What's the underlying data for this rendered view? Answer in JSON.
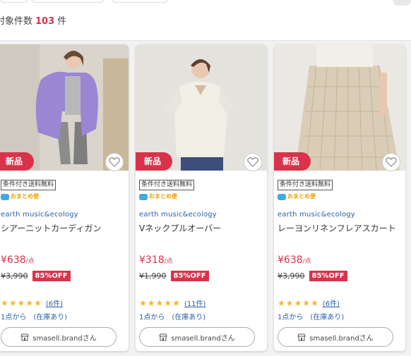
{
  "header": {
    "count_label": "対象件数",
    "count_value": "103",
    "count_unit": "件"
  },
  "products": [
    {
      "badge": "新品",
      "shipping": "条件付き送料無料",
      "bundle": "おまとめ便",
      "brand": "earth music&ecology",
      "title": "シアーニットカーディガン",
      "price": "¥638",
      "price_unit": "/点",
      "original_price": "¥3,990",
      "discount": "85%OFF",
      "rating": 5,
      "review_count": "(6件)",
      "stock": "1点から　(在庫あり)",
      "shop": "smasell.brandさん",
      "photo_colors": {
        "bg": "#d9d4cc",
        "garment": "#9b86d4",
        "pants": "#8c8c8c"
      }
    },
    {
      "badge": "新品",
      "shipping": "条件付き送料無料",
      "bundle": "おまとめ便",
      "brand": "earth music&ecology",
      "title": "Vネックプルオーバー",
      "price": "¥318",
      "price_unit": "/点",
      "original_price": "¥1,990",
      "discount": "85%OFF",
      "rating": 5,
      "review_count": "(11件)",
      "stock": "1点から　(在庫あり)",
      "shop": "smasell.brandさん",
      "photo_colors": {
        "bg": "#e4e2dd",
        "garment": "#f1eee6",
        "pants": "#3e4e7a"
      }
    },
    {
      "badge": "新品",
      "shipping": "条件付き送料無料",
      "bundle": "おまとめ便",
      "brand": "earth music&ecology",
      "title": "レーヨンリネンフレアスカート",
      "price": "¥638",
      "price_unit": "/点",
      "original_price": "¥3,990",
      "discount": "85%OFF",
      "rating": 5,
      "review_count": "(6件)",
      "stock": "1点から　(在庫あり)",
      "shop": "smasell.brandさん",
      "photo_colors": {
        "bg": "#e6e4e0",
        "garment": "#d9cdb8",
        "pants": "#d9cdb8"
      }
    }
  ],
  "colors": {
    "accent": "#d8334a",
    "link": "#2a5fa8",
    "star": "#f5b62a"
  }
}
